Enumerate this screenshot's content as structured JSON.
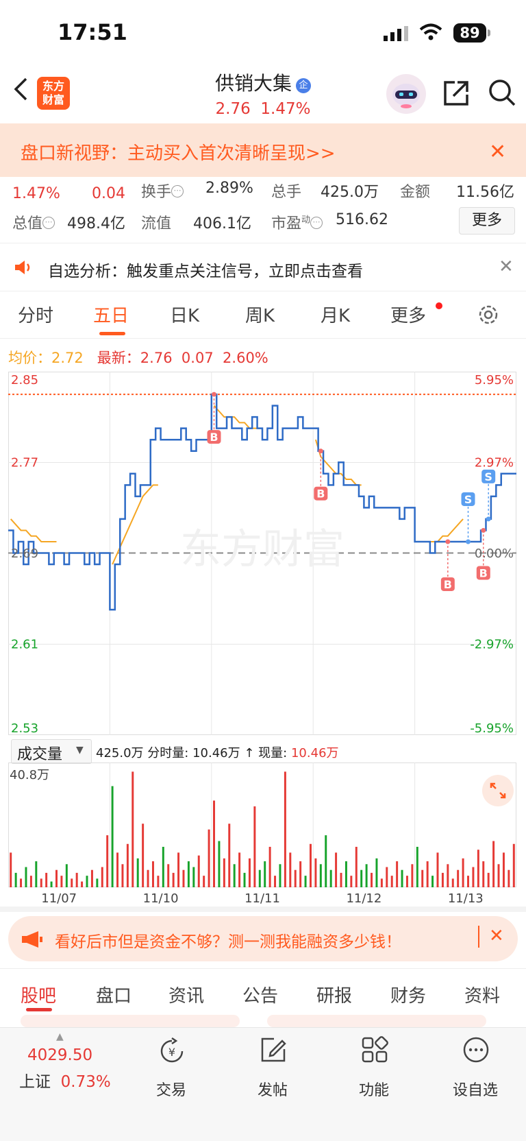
{
  "status_bar": {
    "time": "17:51",
    "battery": "89"
  },
  "header": {
    "logo_line1": "东方",
    "logo_line2": "财富",
    "stock_name": "供销大集",
    "badge": "企",
    "price": "2.76",
    "change_pct": "1.47%"
  },
  "promo": {
    "text": "盘口新视野：主动买入首次清晰呈现>>",
    "close": "✕"
  },
  "quote": {
    "row1": {
      "pct": "1.47%",
      "chg": "0.04",
      "turnover_label": "换手",
      "turnover": "2.89%",
      "volume_label": "总手",
      "volume": "425.0万",
      "amount_label": "金额",
      "amount": "11.56亿"
    },
    "row2": {
      "mcap_label": "总值",
      "mcap": "498.4亿",
      "float_label": "流值",
      "float": "406.1亿",
      "pe_label": "市盈",
      "pe_sup": "动",
      "pe": "516.62",
      "more": "更多"
    }
  },
  "notice": {
    "text": "自选分析：触发重点关注信号，立即点击查看",
    "close": "✕"
  },
  "tabs": [
    "分时",
    "五日",
    "日K",
    "周K",
    "月K",
    "更多"
  ],
  "active_tab": "五日",
  "avg_row": {
    "avg_label": "均价：",
    "avg": "2.72",
    "last_label": "最新：",
    "last": "2.76",
    "chg": "0.07",
    "pct": "2.60%"
  },
  "chart_data": {
    "type": "line",
    "y_left_labels": [
      "2.85",
      "2.77",
      "2.69",
      "2.61",
      "2.53"
    ],
    "y_right_labels": [
      "5.95%",
      "2.97%",
      "0.00%",
      "-2.97%",
      "-5.95%"
    ],
    "ylim": [
      2.53,
      2.85
    ],
    "prev_close": 2.69,
    "ref_line_price": 2.83,
    "x_tick_labels": [
      "11/07",
      "11/10",
      "11/11",
      "11/12",
      "11/13"
    ],
    "watermark": "东方财富",
    "series": [
      {
        "name": "price",
        "values": [
          2.71,
          2.69,
          2.7,
          2.68,
          2.7,
          2.69,
          2.69,
          2.69,
          2.68,
          2.69,
          2.69,
          2.68,
          2.69,
          2.69,
          2.69,
          2.68,
          2.69,
          2.68,
          2.69,
          2.69,
          2.64,
          2.68,
          2.72,
          2.75,
          2.76,
          2.74,
          2.75,
          2.75,
          2.79,
          2.8,
          2.79,
          2.79,
          2.79,
          2.79,
          2.8,
          2.79,
          2.78,
          2.79,
          2.79,
          2.79,
          2.83,
          2.8,
          2.8,
          2.81,
          2.8,
          2.8,
          2.79,
          2.8,
          2.81,
          2.8,
          2.79,
          2.8,
          2.82,
          2.79,
          2.8,
          2.8,
          2.8,
          2.81,
          2.8,
          2.8,
          2.8,
          2.78,
          2.76,
          2.75,
          2.76,
          2.77,
          2.75,
          2.75,
          2.75,
          2.74,
          2.73,
          2.74,
          2.73,
          2.73,
          2.73,
          2.73,
          2.73,
          2.72,
          2.73,
          2.73,
          2.7,
          2.7,
          2.7,
          2.69,
          2.7,
          2.7,
          2.7,
          2.7,
          2.7,
          2.7,
          2.7,
          2.7,
          2.7,
          2.71,
          2.72,
          2.74,
          2.75,
          2.76,
          2.76,
          2.76
        ]
      },
      {
        "name": "avg",
        "values": [
          2.72,
          2.715,
          2.71,
          2.71,
          2.705,
          2.705,
          2.7,
          2.7,
          2.7,
          2.7,
          null,
          null,
          null,
          null,
          null,
          null,
          null,
          null,
          null,
          null,
          2.68,
          2.69,
          2.7,
          2.71,
          2.72,
          2.73,
          2.74,
          2.745,
          2.75,
          2.75,
          null,
          null,
          null,
          null,
          null,
          null,
          null,
          null,
          null,
          null,
          2.82,
          2.815,
          2.81,
          2.81,
          2.81,
          2.805,
          2.805,
          2.8,
          2.8,
          2.8,
          null,
          null,
          null,
          null,
          null,
          null,
          null,
          null,
          null,
          null,
          2.79,
          2.775,
          2.77,
          2.765,
          2.76,
          2.76,
          2.755,
          2.755,
          2.75,
          2.75,
          null,
          null,
          null,
          null,
          null,
          null,
          null,
          null,
          null,
          null,
          2.7,
          2.7,
          2.7,
          2.7,
          2.7,
          2.705,
          2.705,
          2.71,
          2.715,
          2.72,
          null,
          null,
          null,
          null,
          null,
          null,
          null,
          null,
          null,
          null
        ]
      }
    ],
    "markers": [
      {
        "label": "B",
        "index": 40
      },
      {
        "label": "B",
        "index": 61
      },
      {
        "label": "B",
        "index": 86
      },
      {
        "label": "B",
        "index": 93
      },
      {
        "label": "S",
        "index": 90
      },
      {
        "label": "S",
        "index": 94
      }
    ]
  },
  "volume": {
    "selector_label": "成交量",
    "total": "425.0万",
    "minute_label": "分时量:",
    "minute_value": "10.46万",
    "arrow": "↑",
    "now_label": "现量:",
    "now_value": "10.46万",
    "max_label": "40.8万",
    "bars": [
      12,
      5,
      3,
      7,
      4,
      9,
      3,
      5,
      2,
      6,
      4,
      8,
      3,
      5,
      2,
      4,
      6,
      3,
      7,
      18,
      35,
      12,
      8,
      15,
      40,
      10,
      22,
      6,
      9,
      4,
      14,
      8,
      5,
      12,
      6,
      9,
      7,
      11,
      4,
      20,
      30,
      16,
      10,
      22,
      8,
      12,
      5,
      10,
      28,
      6,
      9,
      14,
      4,
      8,
      40,
      12,
      6,
      9,
      4,
      15,
      10,
      8,
      18,
      6,
      12,
      5,
      9,
      4,
      14,
      6,
      8,
      5,
      10,
      3,
      7,
      4,
      9,
      6,
      4,
      8,
      14,
      6,
      9,
      4,
      12,
      5,
      8,
      3,
      6,
      10,
      4,
      7,
      13,
      9,
      5,
      16,
      8,
      12,
      6,
      15
    ]
  },
  "ad": {
    "text": "看好后市但是资金不够？测一测我能融资多少钱！",
    "close": "✕"
  },
  "bottom_tabs": [
    "股吧",
    "盘口",
    "资讯",
    "公告",
    "研报",
    "财务",
    "资料"
  ],
  "bottom_nav": {
    "index_value": "4029.50",
    "index_name": "上证",
    "index_pct": "0.73%",
    "items": [
      "交易",
      "发帖",
      "功能",
      "设自选"
    ]
  }
}
